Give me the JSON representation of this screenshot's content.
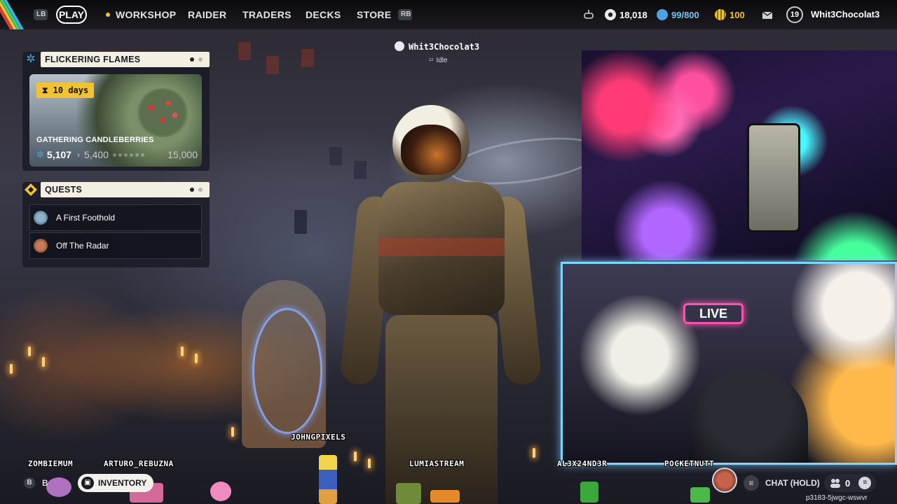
{
  "nav": {
    "lb_hint": "LB",
    "rb_hint": "RB",
    "items": [
      {
        "label": "PLAY"
      },
      {
        "label": "WORKSHOP"
      },
      {
        "label": "RAIDER"
      },
      {
        "label": "TRADERS"
      },
      {
        "label": "DECKS"
      },
      {
        "label": "STORE"
      }
    ],
    "active_index": 0
  },
  "resources": {
    "coins": "18,018",
    "capacity": "99/800",
    "tokens": "100"
  },
  "profile": {
    "level": "19",
    "username": "Whit3Chocolat3"
  },
  "event": {
    "header": "FLICKERING FLAMES",
    "timer": "10 days",
    "title": "GATHERING CANDLEBERRIES",
    "current": "5,107",
    "next": "5,400",
    "max": "15,000",
    "progress_fraction": 0.34
  },
  "quests": {
    "header": "QUESTS",
    "items": [
      {
        "label": "A First Foothold"
      },
      {
        "label": "Off The Radar"
      }
    ]
  },
  "player": {
    "name": "Whit3Chocolat3",
    "status": "Idle"
  },
  "overlay": {
    "live_sign": "LIVE",
    "viewers": [
      "ZOMBIEMUM",
      "ARTURO_REBUZNA",
      "JOHNGPIXELS",
      "LUMIASTREAM",
      "AL3X24ND3R",
      "POCKETNUTT"
    ]
  },
  "footer": {
    "b_hint": "B",
    "back_label": "B",
    "inventory_label": "INVENTORY",
    "chat_label": "CHAT (HOLD)",
    "party_count": "0",
    "session_id": "p3183-5jwgc-wswvr"
  },
  "colors": {
    "accent_yellow": "#f2c330",
    "panel_header": "#f3efe3",
    "capacity_blue": "#4aa3df"
  }
}
